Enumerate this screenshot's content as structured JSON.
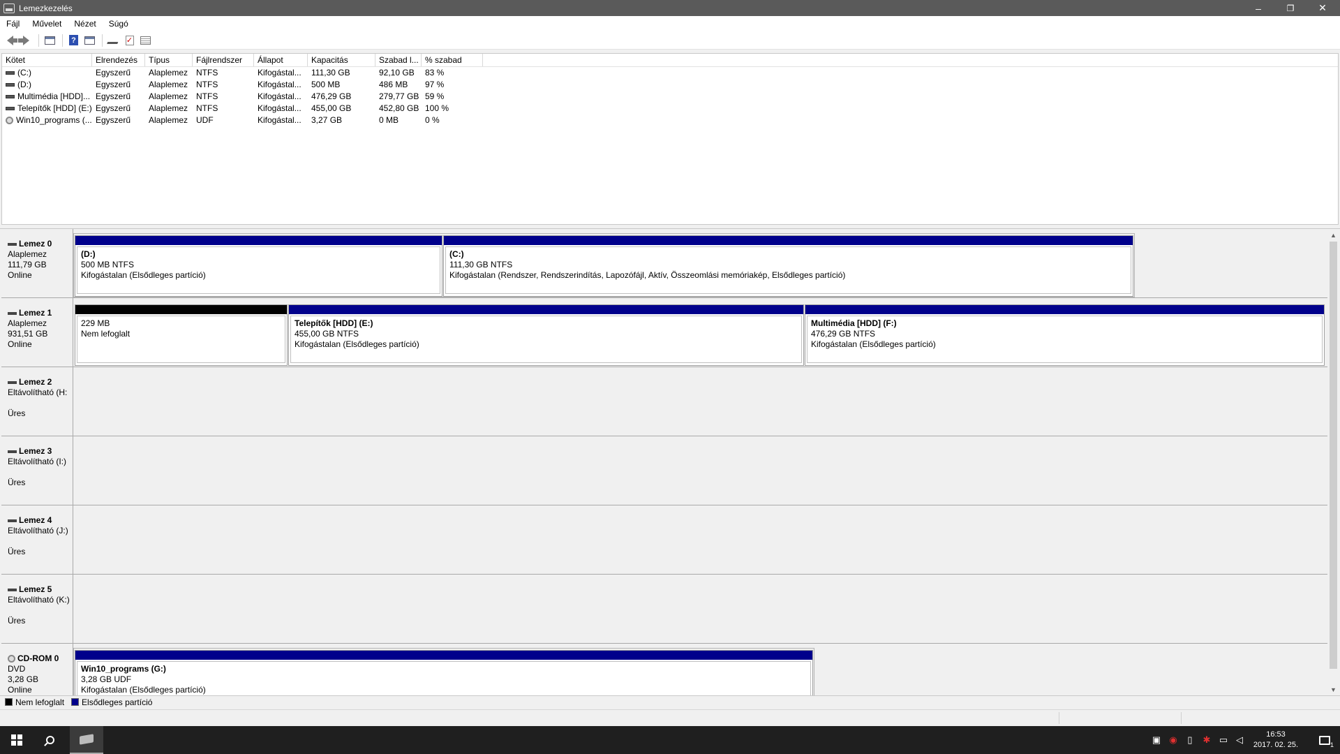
{
  "window": {
    "title": "Lemezkezelés",
    "minimize": "–",
    "restore": "❐",
    "close": "✕"
  },
  "menu": [
    "Fájl",
    "Művelet",
    "Nézet",
    "Súgó"
  ],
  "toolbar": {
    "icons": [
      "back-arrow-icon",
      "forward-arrow-icon",
      "console-tree-icon",
      "help-icon",
      "properties-icon",
      "rescan-icon",
      "check-icon",
      "list-view-icon"
    ],
    "help_glyph": "?",
    "check_glyph": "✓"
  },
  "volume_list": {
    "columns": [
      "Kötet",
      "Elrendezés",
      "Típus",
      "Fájlrendszer",
      "Állapot",
      "Kapacitás",
      "Szabad l...",
      "% szabad"
    ],
    "rows": [
      {
        "icon": "drive-icon",
        "kotet": "(C:)",
        "elrendezes": "Egyszerű",
        "tipus": "Alaplemez",
        "fajlrendszer": "NTFS",
        "allapot": "Kifogástal...",
        "kapacitas": "111,30 GB",
        "szabad": "92,10 GB",
        "szazalek": "83 %"
      },
      {
        "icon": "drive-icon",
        "kotet": "(D:)",
        "elrendezes": "Egyszerű",
        "tipus": "Alaplemez",
        "fajlrendszer": "NTFS",
        "allapot": "Kifogástal...",
        "kapacitas": "500 MB",
        "szabad": "486 MB",
        "szazalek": "97 %"
      },
      {
        "icon": "drive-icon",
        "kotet": "Multimédia [HDD]...",
        "elrendezes": "Egyszerű",
        "tipus": "Alaplemez",
        "fajlrendszer": "NTFS",
        "allapot": "Kifogástal...",
        "kapacitas": "476,29 GB",
        "szabad": "279,77 GB",
        "szazalek": "59 %"
      },
      {
        "icon": "drive-icon",
        "kotet": "Telepítők [HDD] (E:)",
        "elrendezes": "Egyszerű",
        "tipus": "Alaplemez",
        "fajlrendszer": "NTFS",
        "allapot": "Kifogástal...",
        "kapacitas": "455,00 GB",
        "szabad": "452,80 GB",
        "szazalek": "100 %"
      },
      {
        "icon": "cd-icon",
        "kotet": "Win10_programs (...",
        "elrendezes": "Egyszerű",
        "tipus": "Alaplemez",
        "fajlrendszer": "UDF",
        "allapot": "Kifogástal...",
        "kapacitas": "3,27 GB",
        "szabad": "0 MB",
        "szazalek": "0 %"
      }
    ]
  },
  "disks": [
    {
      "name": "Lemez 0",
      "line1": "Alaplemez",
      "line2": "111,79 GB",
      "line3": "Online",
      "icon": "disk-icon",
      "partitions": [
        {
          "title": "(D:)",
          "size": "500 MB NTFS",
          "status": "Kifogástalan (Elsődleges partíció)",
          "bar": "#00008b"
        },
        {
          "title": "(C:)",
          "size": "111,30 GB NTFS",
          "status": "Kifogástalan (Rendszer, Rendszerindítás, Lapozófájl, Aktív, Összeomlási memóriakép, Elsődleges partíció)",
          "bar": "#00008b"
        }
      ]
    },
    {
      "name": "Lemez 1",
      "line1": "Alaplemez",
      "line2": "931,51 GB",
      "line3": "Online",
      "icon": "disk-icon",
      "partitions": [
        {
          "title": "",
          "size": "229 MB",
          "status": "Nem lefoglalt",
          "bar": "#000000"
        },
        {
          "title": "Telepítők [HDD]  (E:)",
          "size": "455,00 GB NTFS",
          "status": "Kifogástalan (Elsődleges partíció)",
          "bar": "#00008b"
        },
        {
          "title": "Multimédia [HDD]  (F:)",
          "size": "476,29 GB NTFS",
          "status": "Kifogástalan (Elsődleges partíció)",
          "bar": "#00008b"
        }
      ]
    },
    {
      "name": "Lemez 2",
      "line1": "Eltávolítható (H:",
      "line2": "",
      "line3": "Üres",
      "icon": "disk-icon",
      "partitions": []
    },
    {
      "name": "Lemez 3",
      "line1": "Eltávolítható (I:)",
      "line2": "",
      "line3": "Üres",
      "icon": "disk-icon",
      "partitions": []
    },
    {
      "name": "Lemez 4",
      "line1": "Eltávolítható (J:)",
      "line2": "",
      "line3": "Üres",
      "icon": "disk-icon",
      "partitions": []
    },
    {
      "name": "Lemez 5",
      "line1": "Eltávolítható (K:)",
      "line2": "",
      "line3": "Üres",
      "icon": "disk-icon",
      "partitions": []
    },
    {
      "name": "CD-ROM 0",
      "line1": "DVD",
      "line2": "3,28 GB",
      "line3": "Online",
      "icon": "cdrom-icon",
      "partitions": [
        {
          "title": "Win10_programs  (G:)",
          "size": "3,28 GB UDF",
          "status": "Kifogástalan (Elsődleges partíció)",
          "bar": "#00008b"
        }
      ]
    }
  ],
  "legend": [
    {
      "label": "Nem lefoglalt",
      "color": "#000000"
    },
    {
      "label": "Elsődleges partíció",
      "color": "#00008b"
    }
  ],
  "taskbar": {
    "tray_icons": [
      "people-icon",
      "antivirus-icon",
      "usb-icon",
      "network-activity-icon",
      "network-icon",
      "volume-icon"
    ],
    "time": "16:53",
    "date": "2017. 02. 25.",
    "notification_count": "1"
  },
  "colors": {
    "primary_partition": "#00008b",
    "unallocated": "#000000",
    "titlebar": "#5a5a5a",
    "taskbar": "#1f1f1f"
  }
}
